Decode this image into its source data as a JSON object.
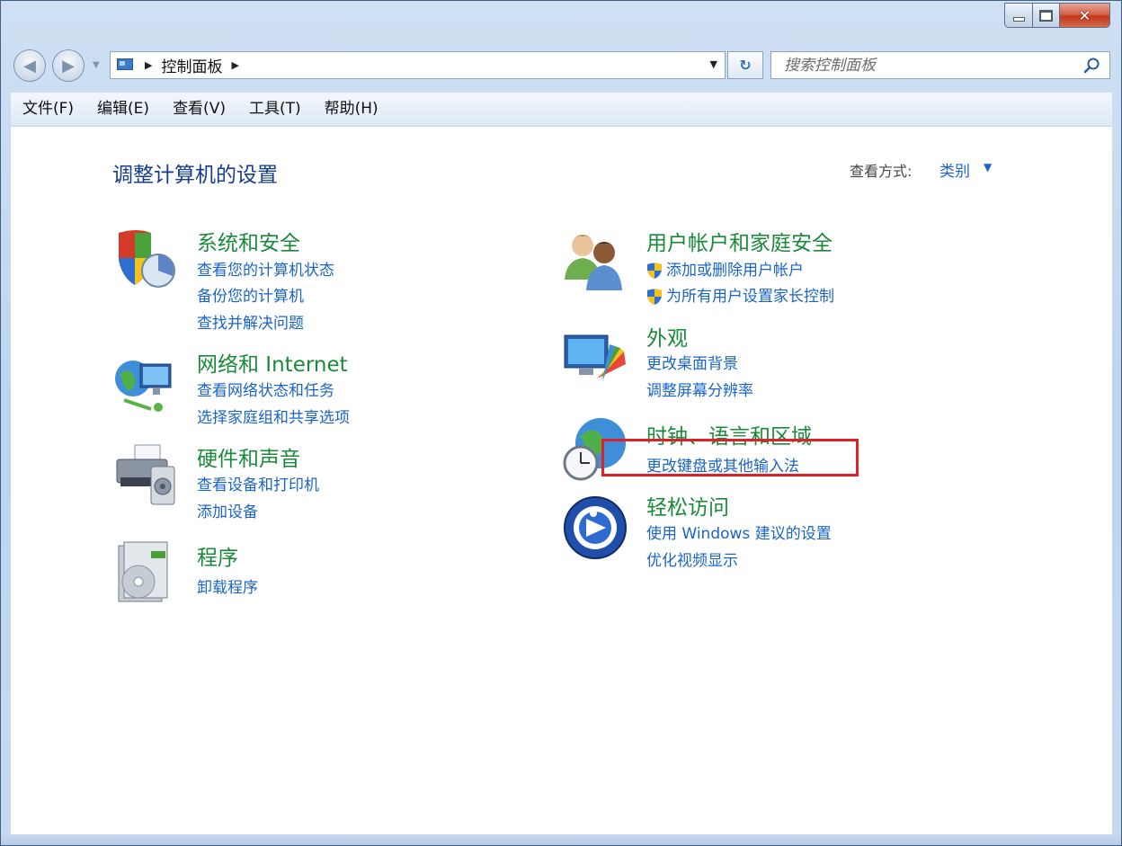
{
  "window": {
    "caption": {
      "minimize": "—",
      "maximize": "□",
      "close": "✕"
    }
  },
  "navigation": {
    "back_icon": "back-arrow-icon",
    "forward_icon": "forward-arrow-icon",
    "address": {
      "crumb": "控制面板"
    },
    "search_placeholder": "搜索控制面板"
  },
  "menubar": {
    "items": [
      "文件(F)",
      "编辑(E)",
      "查看(V)",
      "工具(T)",
      "帮助(H)"
    ]
  },
  "main": {
    "title": "调整计算机的设置",
    "view_by_label": "查看方式:",
    "view_by_value": "类别",
    "categories_left": [
      {
        "title": "系统和安全",
        "links": [
          "查看您的计算机状态",
          "备份您的计算机",
          "查找并解决问题"
        ],
        "icon": "shield-icon"
      },
      {
        "title": "网络和 Internet",
        "links": [
          "查看网络状态和任务",
          "选择家庭组和共享选项"
        ],
        "icon": "network-icon"
      },
      {
        "title": "硬件和声音",
        "links": [
          "查看设备和打印机",
          "添加设备"
        ],
        "icon": "printer-icon"
      },
      {
        "title": "程序",
        "links": [
          "卸载程序"
        ],
        "icon": "programs-icon"
      }
    ],
    "categories_right": [
      {
        "title": "用户帐户和家庭安全",
        "links": [
          "添加或删除用户帐户",
          "为所有用户设置家长控制"
        ],
        "icon": "users-icon"
      },
      {
        "title": "外观",
        "links": [
          "更改桌面背景",
          "调整屏幕分辨率"
        ],
        "icon": "appearance-icon"
      },
      {
        "title": "时钟、语言和区域",
        "links": [
          "更改键盘或其他输入法"
        ],
        "icon": "clock-globe-icon"
      },
      {
        "title": "轻松访问",
        "links": [
          "使用 Windows 建议的设置",
          "优化视频显示"
        ],
        "icon": "ease-of-access-icon"
      }
    ]
  },
  "colors": {
    "category_title": "#1a8a3a",
    "link": "#1a64c8",
    "highlight": "#e0202a"
  }
}
